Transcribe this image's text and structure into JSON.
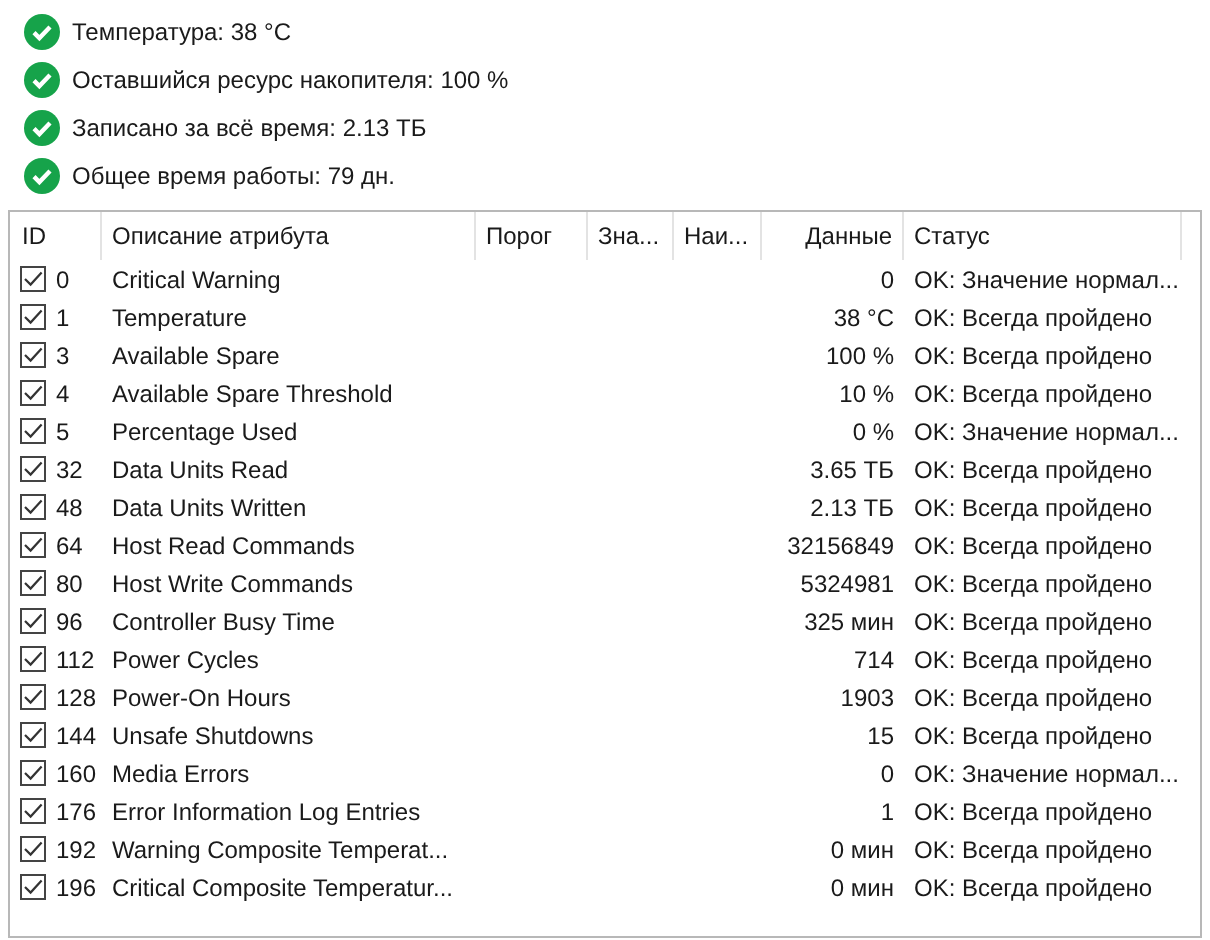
{
  "summary": [
    {
      "text": "Температура: 38 °C",
      "ok": true
    },
    {
      "text": "Оставшийся ресурс накопителя: 100 %",
      "ok": true
    },
    {
      "text": "Записано за всё время: 2.13 ТБ",
      "ok": true
    },
    {
      "text": "Общее время работы: 79 дн.",
      "ok": true
    }
  ],
  "table": {
    "columns": [
      "ID",
      "Описание атрибута",
      "Порог",
      "Зна...",
      "Наи...",
      "Данные",
      "Статус"
    ],
    "rows": [
      {
        "checked": true,
        "id": "0",
        "name": "Critical Warning",
        "data": "0",
        "status": "OK: Значение нормал..."
      },
      {
        "checked": true,
        "id": "1",
        "name": "Temperature",
        "data": "38 °C",
        "status": "OK: Всегда пройдено"
      },
      {
        "checked": true,
        "id": "3",
        "name": "Available Spare",
        "data": "100 %",
        "status": "OK: Всегда пройдено"
      },
      {
        "checked": true,
        "id": "4",
        "name": "Available Spare Threshold",
        "data": "10 %",
        "status": "OK: Всегда пройдено"
      },
      {
        "checked": true,
        "id": "5",
        "name": "Percentage Used",
        "data": "0 %",
        "status": "OK: Значение нормал..."
      },
      {
        "checked": true,
        "id": "32",
        "name": "Data Units Read",
        "data": "3.65 ТБ",
        "status": "OK: Всегда пройдено"
      },
      {
        "checked": true,
        "id": "48",
        "name": "Data Units Written",
        "data": "2.13 ТБ",
        "status": "OK: Всегда пройдено"
      },
      {
        "checked": true,
        "id": "64",
        "name": "Host Read Commands",
        "data": "32156849",
        "status": "OK: Всегда пройдено"
      },
      {
        "checked": true,
        "id": "80",
        "name": "Host Write Commands",
        "data": "5324981",
        "status": "OK: Всегда пройдено"
      },
      {
        "checked": true,
        "id": "96",
        "name": "Controller Busy Time",
        "data": "325 мин",
        "status": "OK: Всегда пройдено"
      },
      {
        "checked": true,
        "id": "112",
        "name": "Power Cycles",
        "data": "714",
        "status": "OK: Всегда пройдено"
      },
      {
        "checked": true,
        "id": "128",
        "name": "Power-On Hours",
        "data": "1903",
        "status": "OK: Всегда пройдено"
      },
      {
        "checked": true,
        "id": "144",
        "name": "Unsafe Shutdowns",
        "data": "15",
        "status": "OK: Всегда пройдено"
      },
      {
        "checked": true,
        "id": "160",
        "name": "Media Errors",
        "data": "0",
        "status": "OK: Значение нормал..."
      },
      {
        "checked": true,
        "id": "176",
        "name": "Error Information Log Entries",
        "data": "1",
        "status": "OK: Всегда пройдено"
      },
      {
        "checked": true,
        "id": "192",
        "name": "Warning Composite Temperat...",
        "data": "0 мин",
        "status": "OK: Всегда пройдено"
      },
      {
        "checked": true,
        "id": "196",
        "name": "Critical Composite Temperatur...",
        "data": "0 мин",
        "status": "OK: Всегда пройдено"
      }
    ]
  }
}
